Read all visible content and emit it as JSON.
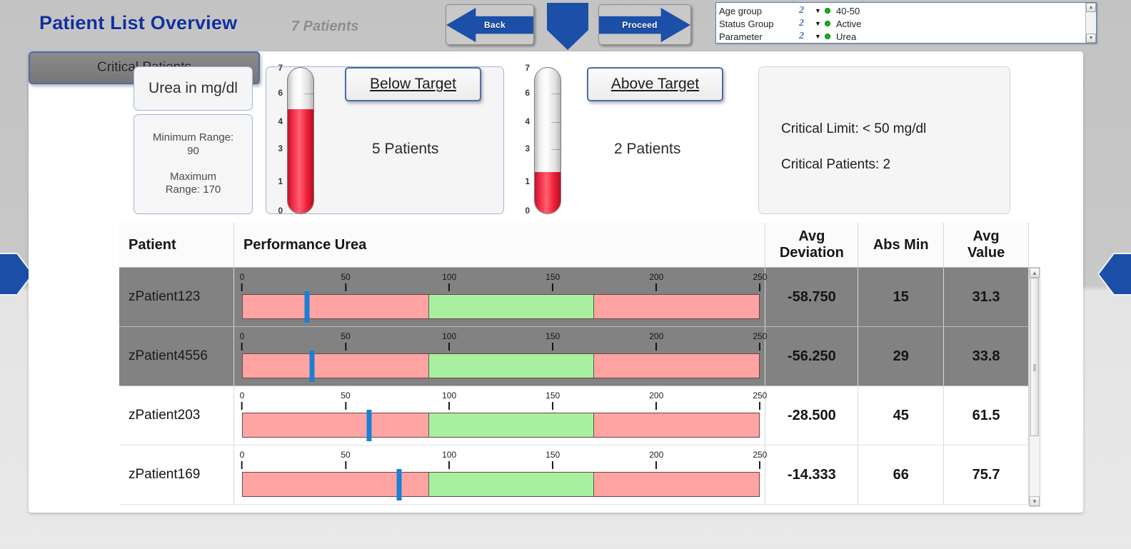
{
  "header": {
    "title": "Patient List Overview",
    "patient_count": "7 Patients",
    "back_label": "Back",
    "proceed_label": "Proceed",
    "down_icon": "down-arrow-icon",
    "left_side_icon": "left-page-arrow-icon",
    "right_side_icon": "right-page-arrow-icon"
  },
  "filters": {
    "rows": [
      {
        "name": "Age group",
        "glyph": "2",
        "caret": "▼",
        "status": "green",
        "value": "40-50"
      },
      {
        "name": "Status Group",
        "glyph": "2",
        "caret": "▼",
        "status": "green",
        "value": "Active"
      },
      {
        "name": "Parameter",
        "glyph": "2",
        "caret": "▼",
        "status": "green",
        "value": "Urea"
      }
    ],
    "scroll_up": "▲",
    "scroll_down": "▼"
  },
  "parameter": {
    "title": "Urea in mg/dl",
    "minimum_label": "Minimum Range:",
    "minimum_value": "90",
    "maximum_label": "Maximum",
    "maximum_value": "Range: 170"
  },
  "below_target": {
    "button_label": "Below Target",
    "count_text": "5 Patients",
    "gauge": {
      "value": 5,
      "max": 7,
      "ticks": [
        "7",
        "6",
        "4",
        "3",
        "1",
        "0"
      ]
    }
  },
  "above_target": {
    "button_label": "Above Target",
    "count_text": "2 Patients",
    "gauge": {
      "value": 2,
      "max": 7,
      "ticks": [
        "7",
        "6",
        "4",
        "3",
        "1",
        "0"
      ]
    }
  },
  "critical": {
    "button_label": "Critical Patients",
    "limit_text": "Critical Limit: < 50 mg/dl",
    "count_text": "Critical Patients: 2"
  },
  "table": {
    "columns": [
      "Patient",
      "Performance Urea",
      "Avg Deviation",
      "Abs Min",
      "Avg Value"
    ],
    "col_avg_dev_line1": "Avg",
    "col_avg_dev_line2": "Deviation",
    "col_abs_min": "Abs Min",
    "col_avg_val_line1": "Avg",
    "col_avg_val_line2": "Value",
    "rows": [
      {
        "patient": "zPatient123",
        "avg_deviation": "-58.750",
        "abs_min": "15",
        "avg_value": "31.3",
        "selected": true
      },
      {
        "patient": "zPatient4556",
        "avg_deviation": "-56.250",
        "abs_min": "29",
        "avg_value": "33.8",
        "selected": true
      },
      {
        "patient": "zPatient203",
        "avg_deviation": "-28.500",
        "abs_min": "45",
        "avg_value": "61.5",
        "selected": false
      },
      {
        "patient": "zPatient169",
        "avg_deviation": "-14.333",
        "abs_min": "66",
        "avg_value": "75.7",
        "selected": false
      }
    ],
    "scroll_up": "▲",
    "scroll_down": "▼"
  },
  "chart_data": {
    "type": "bar",
    "title": "Performance Urea",
    "xlabel": "Urea in mg/dl",
    "ylabel": "",
    "axis_ticks": [
      0,
      50,
      100,
      150,
      200,
      250
    ],
    "xlim": [
      0,
      250
    ],
    "grid": false,
    "legend": "none",
    "target_band": {
      "min": 90,
      "max": 170,
      "color": "#a8f0a0"
    },
    "out_of_range_color": "#ffa3a3",
    "marker_color": "#1b7fd4",
    "categories": [
      "zPatient123",
      "zPatient4556",
      "zPatient203",
      "zPatient169"
    ],
    "series": [
      {
        "name": "Avg Value",
        "values": [
          31.3,
          33.8,
          61.5,
          75.7
        ]
      },
      {
        "name": "Avg Deviation",
        "values": [
          -58.75,
          -56.25,
          -28.5,
          -14.333
        ]
      },
      {
        "name": "Abs Min",
        "values": [
          15,
          29,
          45,
          66
        ]
      }
    ],
    "summary": {
      "total_patients": 7,
      "below_target": 5,
      "above_target": 2,
      "critical_patients": 2,
      "critical_limit": 50,
      "range_min": 90,
      "range_max": 170
    }
  },
  "colors": {
    "title_blue": "#12309b",
    "accent_blue": "#1b4fa8",
    "selected_row": "#828282",
    "good_band": "#a8f0a0",
    "bad_band": "#ffa3a3",
    "marker": "#1b7fd4",
    "status_green": "#15b215"
  }
}
